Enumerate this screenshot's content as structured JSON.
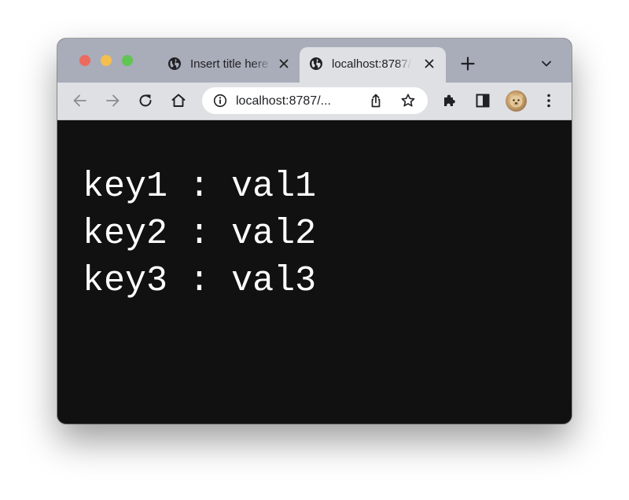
{
  "browser": {
    "tabs": [
      {
        "title": "Insert title here",
        "active": false,
        "icon": "globe-icon"
      },
      {
        "title": "localhost:8787/",
        "active": true,
        "icon": "globe-icon"
      }
    ],
    "address_bar": {
      "url": "localhost:8787/..."
    },
    "icons": {
      "back": "arrow-left-icon",
      "forward": "arrow-right-icon",
      "reload": "reload-icon",
      "home": "home-icon",
      "info": "info-icon",
      "share": "share-icon",
      "bookmark": "star-icon",
      "extensions": "puzzle-icon",
      "side_panel": "side-panel-icon",
      "menu": "kebab-menu-icon",
      "new_tab": "plus-icon",
      "tab_search": "chevron-down-icon"
    },
    "colors": {
      "tabstrip": "#a9acb9",
      "toolbar": "#dfe0e4",
      "page_background": "#111111",
      "page_text": "#ffffff",
      "close_light": "#ec6a5e",
      "minimize_light": "#f4bf4f",
      "maximize_light": "#61c554"
    }
  },
  "page": {
    "lines": [
      {
        "key": "key1",
        "separator": ":",
        "value": "val1"
      },
      {
        "key": "key2",
        "separator": ":",
        "value": "val2"
      },
      {
        "key": "key3",
        "separator": ":",
        "value": "val3"
      }
    ]
  }
}
